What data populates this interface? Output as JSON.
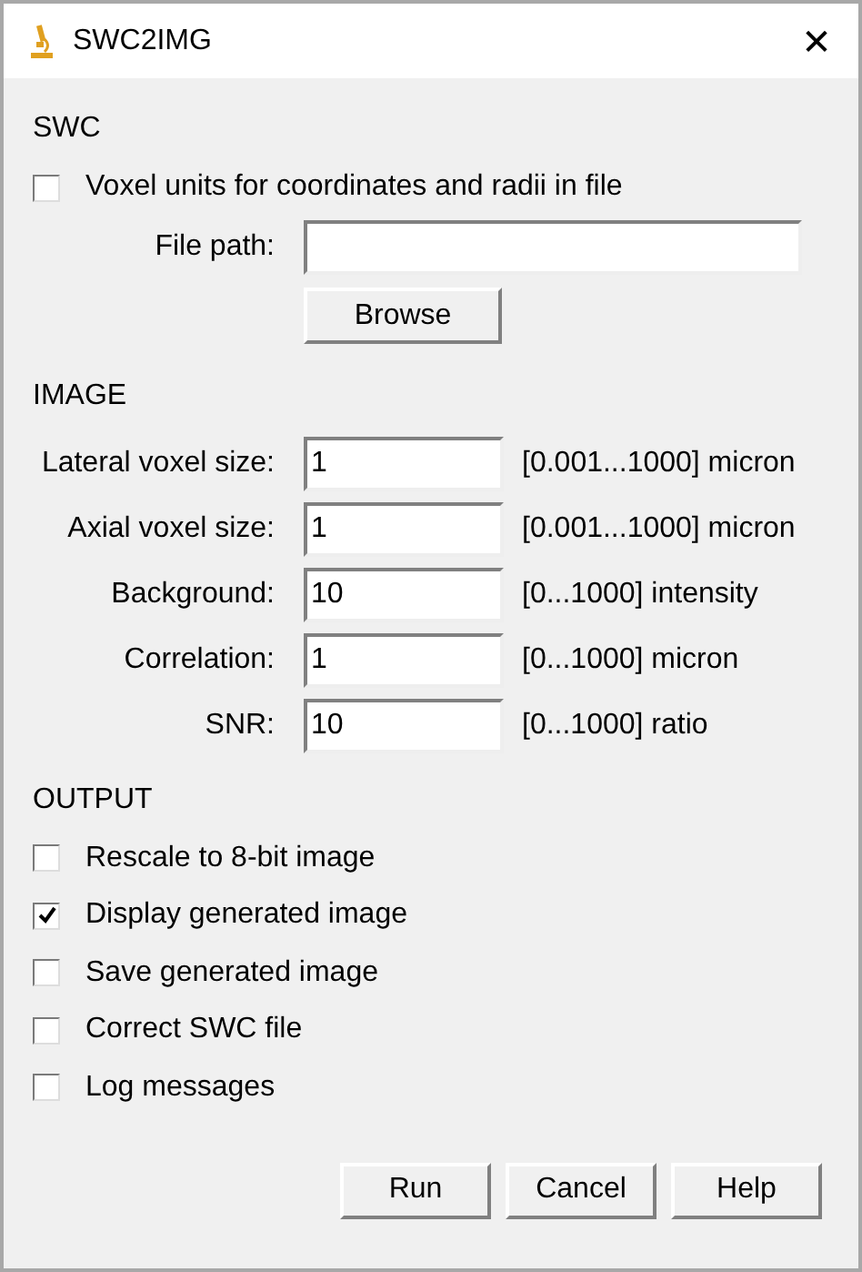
{
  "window": {
    "title": "SWC2IMG",
    "close": "✕"
  },
  "swc": {
    "heading": "SWC",
    "checkbox": {
      "label": "Voxel units for coordinates and radii in file",
      "checked": false
    },
    "file_path": {
      "label": "File path:"
    },
    "browse": "Browse"
  },
  "image": {
    "heading": "IMAGE",
    "fields": [
      {
        "label": "Lateral voxel size:",
        "value": "1",
        "range": "[0.001...1000] micron"
      },
      {
        "label": "Axial voxel size:",
        "value": "1",
        "range": "[0.001...1000] micron"
      },
      {
        "label": "Background:",
        "value": "10",
        "range": "[0...1000] intensity"
      },
      {
        "label": "Correlation:",
        "value": "1",
        "range": "[0...1000] micron"
      },
      {
        "label": "SNR:",
        "value": "10",
        "range": "[0...1000] ratio"
      }
    ]
  },
  "output": {
    "heading": "OUTPUT",
    "options": [
      {
        "label": "Rescale to 8-bit image",
        "checked": false
      },
      {
        "label": "Display generated image",
        "checked": true
      },
      {
        "label": "Save generated image",
        "checked": false
      },
      {
        "label": "Correct SWC file",
        "checked": false
      },
      {
        "label": "Log messages",
        "checked": false
      }
    ]
  },
  "buttons": [
    "Run",
    "Cancel",
    "Help"
  ]
}
